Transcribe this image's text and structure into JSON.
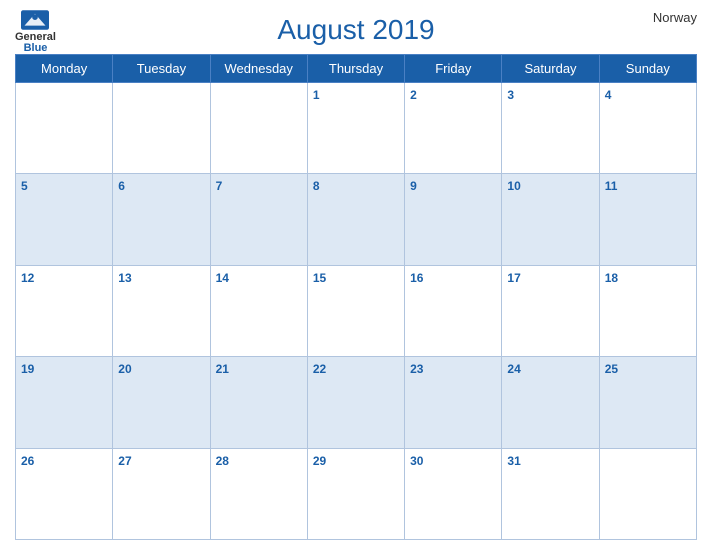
{
  "header": {
    "title": "August 2019",
    "country": "Norway",
    "logo": {
      "general": "General",
      "blue": "Blue"
    }
  },
  "days_of_week": [
    "Monday",
    "Tuesday",
    "Wednesday",
    "Thursday",
    "Friday",
    "Saturday",
    "Sunday"
  ],
  "weeks": [
    [
      null,
      null,
      null,
      1,
      2,
      3,
      4
    ],
    [
      5,
      6,
      7,
      8,
      9,
      10,
      11
    ],
    [
      12,
      13,
      14,
      15,
      16,
      17,
      18
    ],
    [
      19,
      20,
      21,
      22,
      23,
      24,
      25
    ],
    [
      26,
      27,
      28,
      29,
      30,
      31,
      null
    ]
  ]
}
